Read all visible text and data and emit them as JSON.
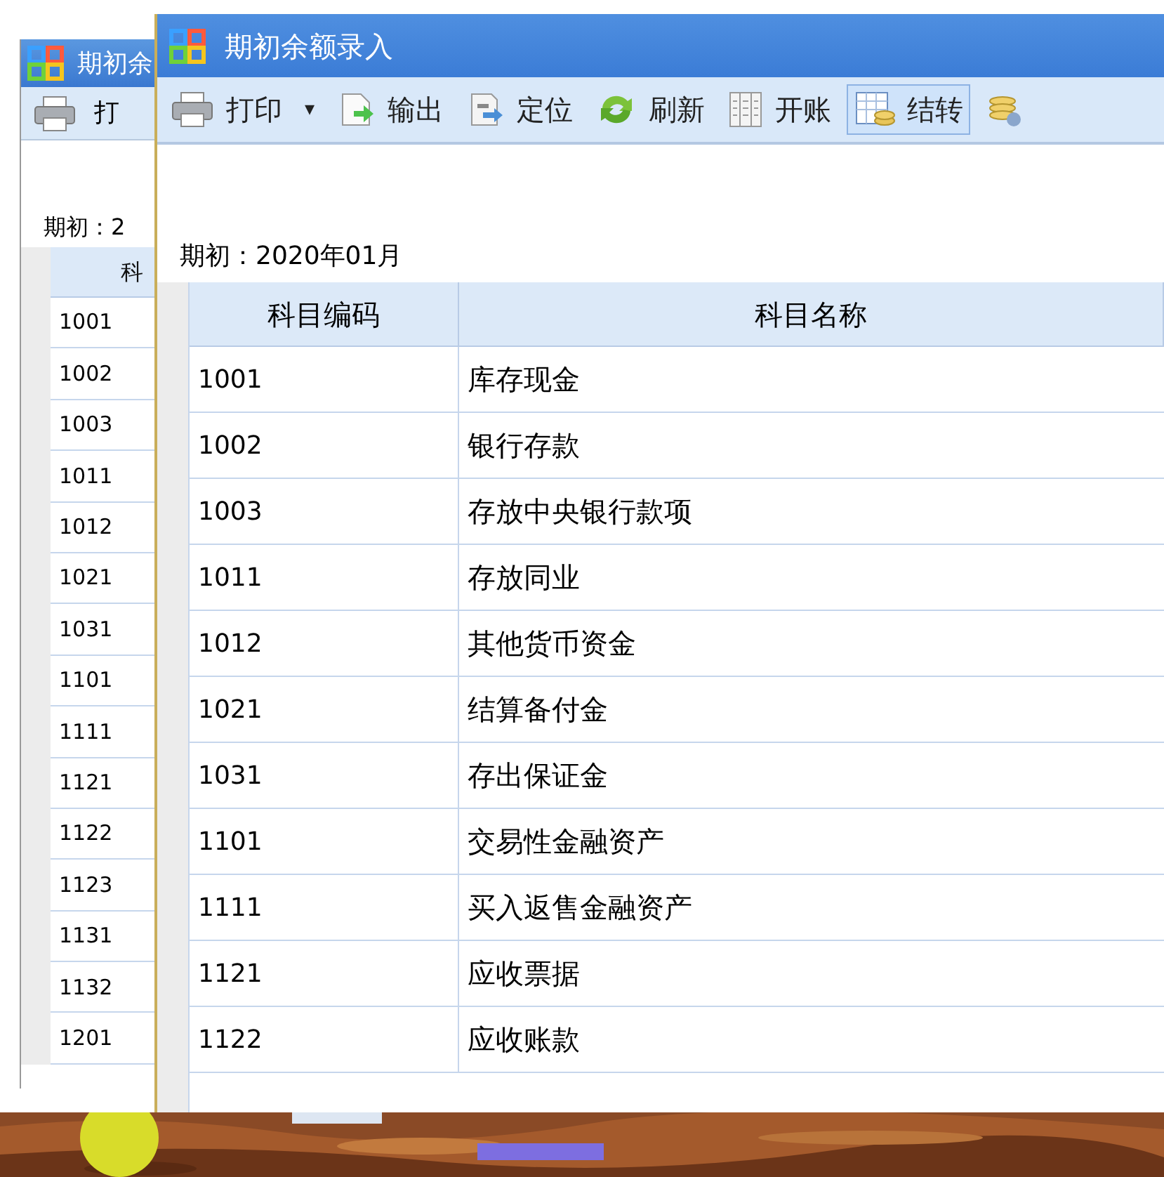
{
  "back_window": {
    "title": "期初余",
    "toolbar": [
      {
        "label": "打"
      }
    ],
    "period": "期初：2",
    "header": "科",
    "rows": [
      "1001",
      "1002",
      "1003",
      "1011",
      "1012",
      "1021",
      "1031",
      "1101",
      "1111",
      "1121",
      "1122",
      "1123",
      "1131",
      "1132",
      "1201"
    ]
  },
  "front_window": {
    "title": "期初余额录入",
    "toolbar": [
      {
        "kind": "dropdown",
        "label": "打印",
        "caret": "▾",
        "selected": false
      },
      {
        "kind": "button",
        "label": "输出",
        "selected": false
      },
      {
        "kind": "button",
        "label": "定位",
        "selected": false
      },
      {
        "kind": "button",
        "label": "刷新",
        "selected": false
      },
      {
        "kind": "button",
        "label": "开账",
        "selected": false
      },
      {
        "kind": "button",
        "label": "结转",
        "selected": true
      },
      {
        "kind": "cutoff",
        "selected": false
      }
    ],
    "period": "期初：2020年01月",
    "columns": [
      "科目编码",
      "科目名称"
    ],
    "rows": [
      {
        "code": "1001",
        "name": "库存现金"
      },
      {
        "code": "1002",
        "name": "银行存款"
      },
      {
        "code": "1003",
        "name": "存放中央银行款项"
      },
      {
        "code": "1011",
        "name": "存放同业"
      },
      {
        "code": "1012",
        "name": "其他货币资金"
      },
      {
        "code": "1021",
        "name": "结算备付金"
      },
      {
        "code": "1031",
        "name": "存出保证金"
      },
      {
        "code": "1101",
        "name": "交易性金融资产"
      },
      {
        "code": "1111",
        "name": "买入返售金融资产"
      },
      {
        "code": "1121",
        "name": "应收票据"
      },
      {
        "code": "1122",
        "name": "应收账款"
      }
    ]
  }
}
